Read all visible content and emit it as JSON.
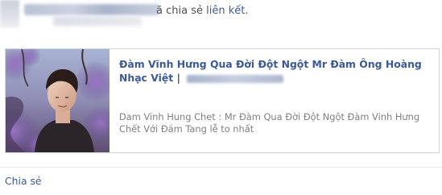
{
  "header": {
    "action_text": "ã chia sẻ ",
    "link_text": "liên kết",
    "trailing": "."
  },
  "link_card": {
    "title": "Đàm Vĩnh Hưng Qua Đời Đột Ngột Mr Đàm Ông Hoàng Nhạc Việt",
    "title_separator": " | ",
    "description": "Dam Vinh Hung Chet : Mr Đàm Qua Đời Đột Ngột Đàm Vinh Hưng Chết Với Đám Tang lễ to nhất",
    "thumbnail_icon": "person-photo-thumbnail"
  },
  "footer": {
    "share_label": "Chia sẻ"
  },
  "colors": {
    "link": "#3b5998",
    "description": "#7f7f7f",
    "border": "#d3d6db"
  }
}
